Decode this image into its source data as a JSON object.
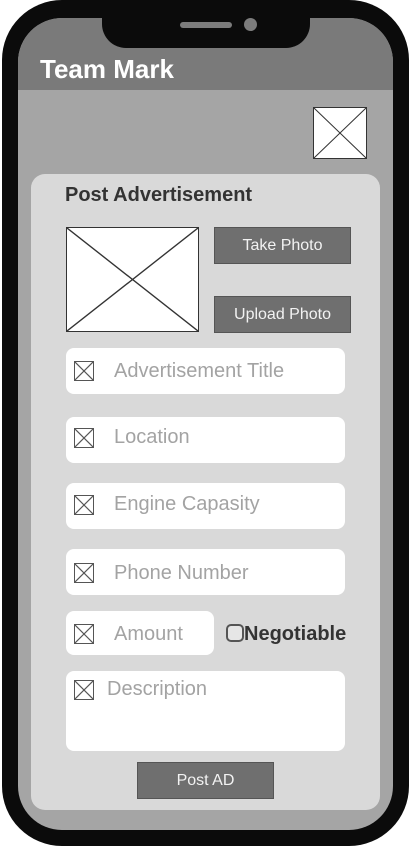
{
  "app": {
    "title": "Team Mark"
  },
  "form": {
    "title": "Post Advertisement",
    "take_photo_label": "Take Photo",
    "upload_photo_label": "Upload Photo",
    "fields": {
      "title": "Advertisement Title",
      "location": "Location",
      "engine": "Engine Capasity",
      "phone": "Phone Number",
      "amount": "Amount",
      "description": "Description"
    },
    "negotiable_label": "Negotiable",
    "negotiable_checked": false,
    "submit_label": "Post AD"
  },
  "icons": {
    "image_placeholder": "image-placeholder-icon",
    "field_icon": "placeholder-x-icon"
  },
  "colors": {
    "header": "#7a7a7a",
    "screen": "#a5a5a5",
    "card": "#d9d9d9",
    "button": "#6f6f6f",
    "frame": "#0b0b0b"
  }
}
